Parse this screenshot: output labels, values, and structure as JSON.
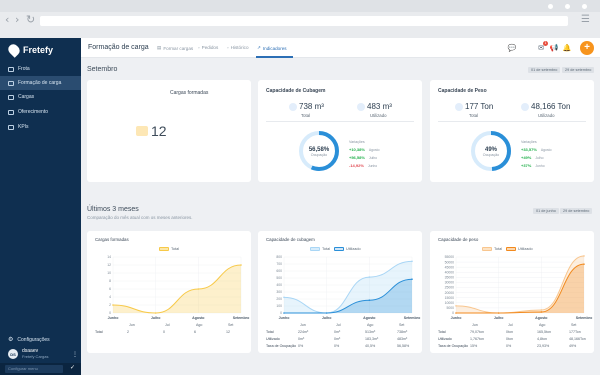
{
  "app": {
    "logo_text": "Fretefy",
    "page_title": "Formação de carga",
    "tabs": [
      {
        "label": "Formar cargas"
      },
      {
        "label": "Pedidos"
      },
      {
        "label": "Histórico"
      },
      {
        "label": "Indicadores",
        "active": true
      }
    ],
    "notifications_badge": "1",
    "accent_color": "#2c6fb5",
    "add_color": "#f7941d"
  },
  "sidebar": {
    "items": [
      {
        "label": "Frota",
        "icon": "truck-icon"
      },
      {
        "label": "Formação de carga",
        "icon": "boxes-icon",
        "active": true
      },
      {
        "label": "Cargas",
        "icon": "box-icon"
      },
      {
        "label": "Oferecimento",
        "icon": "megaphone-icon"
      },
      {
        "label": "KPIs",
        "icon": "chart-icon"
      }
    ],
    "settings_label": "Configurações",
    "user": {
      "initials": "DS",
      "name": "dsaaev",
      "company": "Fretefy Cargas"
    },
    "bottom_input": "Configurar menu"
  },
  "semestre": {
    "title": "Setembro",
    "chips": [
      "01 de setembro",
      "29 de setembro"
    ],
    "cargas_formadas": {
      "title": "Cargas formadas",
      "value": "12"
    },
    "cubagem": {
      "title": "Capacidade de Cubagem",
      "total_value": "738 m³",
      "total_label": "Total",
      "used_value": "483 m³",
      "used_label": "Utilizado",
      "percent": 56.58,
      "percent_label": "56,58%",
      "percent_sub": "Ocupação",
      "variations_label": "Variações",
      "variations": [
        {
          "value": "+10,38%",
          "name": "Agosto",
          "sign": "pos"
        },
        {
          "value": "+56,58%",
          "name": "Julho",
          "sign": "pos"
        },
        {
          "value": "-14,92%",
          "name": "Junho",
          "sign": "neg"
        }
      ]
    },
    "peso": {
      "title": "Capacidade de Peso",
      "total_value": "177 Ton",
      "total_label": "Total",
      "used_value": "48,166 Ton",
      "used_label": "Utilizado",
      "percent": 49,
      "percent_label": "49%",
      "percent_sub": "Ocupação",
      "variations_label": "Variações",
      "variations": [
        {
          "value": "+33,57%",
          "name": "Agosto",
          "sign": "pos"
        },
        {
          "value": "+49%",
          "name": "Julho",
          "sign": "pos"
        },
        {
          "value": "+37%",
          "name": "Junho",
          "sign": "pos"
        }
      ]
    }
  },
  "ultimos": {
    "title": "Últimos 3 meses",
    "subtitle": "Comparação do mês atual com os meses anteriores.",
    "chips": [
      "01 de junho",
      "29 de setembro"
    ]
  },
  "chart_data": [
    {
      "type": "area",
      "title": "Cargas formadas",
      "categories": [
        "Junho",
        "Julho",
        "Agosto",
        "Setembro"
      ],
      "series": [
        {
          "name": "Total",
          "values": [
            2,
            0,
            6,
            12
          ],
          "color": "#f7c948"
        }
      ],
      "ylim": [
        0,
        14
      ],
      "yticks": [
        0,
        2,
        4,
        6,
        8,
        10,
        12,
        14
      ],
      "table": {
        "columns": [
          "Jun",
          "Jul",
          "Ago",
          "Set"
        ],
        "rows": [
          {
            "label": "Total",
            "values": [
              "2",
              "0",
              "6",
              "12"
            ]
          }
        ]
      }
    },
    {
      "type": "area",
      "title": "Capacidade de cubagem",
      "categories": [
        "Junho",
        "Julho",
        "Agosto",
        "Setembro"
      ],
      "series": [
        {
          "name": "Total",
          "values": [
            224,
            0,
            513,
            738
          ],
          "color": "#a9d6f5"
        },
        {
          "name": "Utilizado",
          "values": [
            0,
            0,
            183,
            483
          ],
          "color": "#2a8fd8"
        }
      ],
      "ylim": [
        0,
        800
      ],
      "yticks": [
        0,
        100,
        200,
        300,
        400,
        500,
        600,
        700,
        800
      ],
      "table": {
        "columns": [
          "Jun",
          "Jul",
          "Ago",
          "Set"
        ],
        "rows": [
          {
            "label": "Total",
            "values": [
              "224m³",
              "0m³",
              "513m³",
              "738m³"
            ]
          },
          {
            "label": "Utilizado",
            "values": [
              "0m³",
              "0m³",
              "183,3m³",
              "483m³"
            ]
          },
          {
            "label": "Taxa de Ocupação",
            "values": [
              "0%",
              "0%",
              "40,5%",
              "56,58%"
            ]
          }
        ]
      }
    },
    {
      "type": "area",
      "title": "Capacidade de peso",
      "categories": [
        "Junho",
        "Julho",
        "Agosto",
        "Setembro"
      ],
      "series": [
        {
          "name": "Total",
          "values": [
            7,
            0,
            3,
            56
          ],
          "color": "#f8c68f"
        },
        {
          "name": "Utilizado",
          "values": [
            0,
            0,
            1,
            48
          ],
          "color": "#f28a1e"
        }
      ],
      "ylim": [
        0,
        55000
      ],
      "yticks": [
        0,
        5000,
        10000,
        15000,
        20000,
        25000,
        30000,
        35000,
        40000,
        45000,
        50000,
        55000
      ],
      "series_scaled": [
        {
          "name": "Total",
          "values": [
            7000,
            0,
            3000,
            56000
          ]
        },
        {
          "name": "Utilizado",
          "values": [
            0,
            0,
            1000,
            48000
          ]
        }
      ],
      "table": {
        "columns": [
          "Jun",
          "Jul",
          "Ago",
          "Set"
        ],
        "rows": [
          {
            "label": "Total",
            "values": [
              "79,07ton",
              "0ton",
              "165,5ton",
              "177Ton"
            ]
          },
          {
            "label": "Utilizado",
            "values": [
              "1,767ton",
              "0ton",
              "4,8ton",
              "48,166Ton"
            ]
          },
          {
            "label": "Taxa de Ocupação",
            "values": [
              "15%",
              "0%",
              "23,93%",
              "49%"
            ]
          }
        ]
      }
    }
  ]
}
